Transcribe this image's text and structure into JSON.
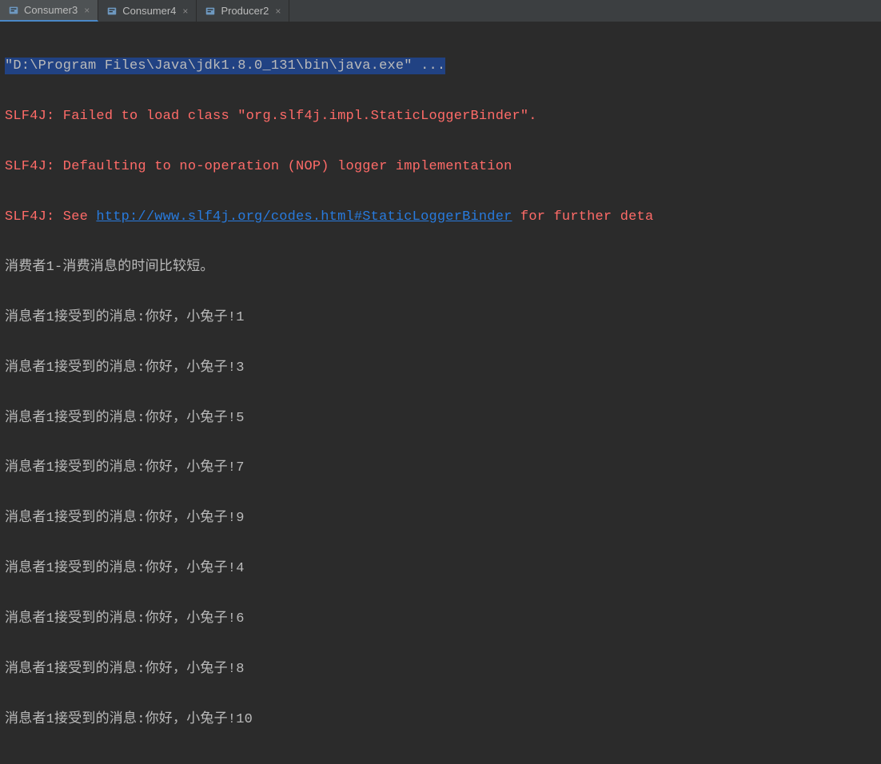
{
  "tabs": [
    {
      "label": "Consumer3",
      "active": true
    },
    {
      "label": "Consumer4",
      "active": false
    },
    {
      "label": "Producer2",
      "active": false
    }
  ],
  "console": {
    "command": "\"D:\\Program Files\\Java\\jdk1.8.0_131\\bin\\java.exe\" ...",
    "errors": [
      "SLF4J: Failed to load class \"org.slf4j.impl.StaticLoggerBinder\".",
      "SLF4J: Defaulting to no-operation (NOP) logger implementation"
    ],
    "link_prefix": "SLF4J: See ",
    "link_text": "http://www.slf4j.org/codes.html#StaticLoggerBinder",
    "link_suffix": " for further deta",
    "header_out": "消费者1-消费消息的时间比较短。",
    "messages": [
      "消息者1接受到的消息:你好，小兔子!1",
      "消息者1接受到的消息:你好，小兔子!3",
      "消息者1接受到的消息:你好，小兔子!5",
      "消息者1接受到的消息:你好，小兔子!7",
      "消息者1接受到的消息:你好，小兔子!9",
      "消息者1接受到的消息:你好，小兔子!4",
      "消息者1接受到的消息:你好，小兔子!6",
      "消息者1接受到的消息:你好，小兔子!8",
      "消息者1接受到的消息:你好，小兔子!10"
    ]
  }
}
